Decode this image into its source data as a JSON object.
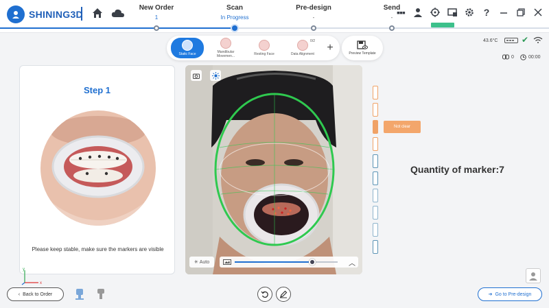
{
  "app": {
    "logo_text": "SHINING3D",
    "brand_color": "#1f6fd0"
  },
  "workflow": {
    "steps": [
      {
        "label": "New Order",
        "sub": "1"
      },
      {
        "label": "Scan",
        "sub": "In Progress"
      },
      {
        "label": "Pre-design",
        "sub": "-"
      },
      {
        "label": "Send",
        "sub": "-"
      }
    ],
    "active_step": "Scan"
  },
  "header_icons": [
    "grid-dots-icon",
    "user-icon",
    "target-icon",
    "screen-capture-icon",
    "gear-icon",
    "help-icon",
    "minimize-icon",
    "restore-icon",
    "close-icon"
  ],
  "modes": [
    {
      "label": "Static Face"
    },
    {
      "label": "Mandibular Movemen..."
    },
    {
      "label": "Resting Face"
    },
    {
      "label": "Data Alignment",
      "badge": "0/2"
    }
  ],
  "active_mode": "Static Face",
  "add_label": "+",
  "preview_template_label": "Preview Template",
  "status": {
    "temperature": "43.6°C",
    "link_count": "0",
    "timer": "00:00"
  },
  "left_panel": {
    "title": "Step 1",
    "instruction": "Please keep stable, make sure the markers are visible"
  },
  "camera": {
    "auto_label": "Auto",
    "exposure": 0.75
  },
  "markers": {
    "colors": [
      "#f0a266",
      "#f0a266",
      "#f0a266",
      "#f0a266",
      "#5b93b5",
      "#5b93b5",
      "#8fb4cc",
      "#8fb4cc",
      "#8fb4cc",
      "#5b93b5"
    ],
    "active_index": 2,
    "tag_label": "Not clear"
  },
  "quantity_text": "Quantity of marker:7",
  "footer": {
    "back_label": "Back to Order",
    "go_label": "Go to Pre-design",
    "axis_x": "x",
    "axis_y": "y"
  }
}
